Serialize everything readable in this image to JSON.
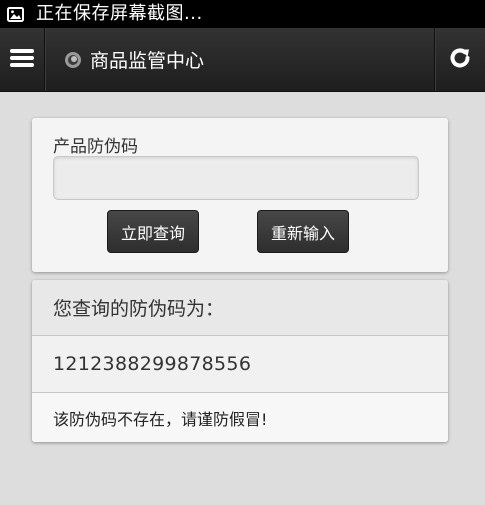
{
  "status_bar": {
    "text": "正在保存屏幕截图...",
    "icon": "image-icon"
  },
  "header": {
    "title": "商品监管中心",
    "menu_icon": "hamburger-menu-icon",
    "logo_icon": "circle-logo-icon",
    "refresh_icon": "refresh-icon"
  },
  "search_form": {
    "label": "产品防伪码",
    "input_value": "",
    "input_placeholder": "",
    "query_button": "立即查询",
    "reset_button": "重新输入"
  },
  "result": {
    "heading": "您查询的防伪码为：",
    "code": "1212388299878556",
    "message": "该防伪码不存在，请谨防假冒!"
  },
  "colors": {
    "status_bar_bg": "#000000",
    "header_bg": "#262626",
    "page_bg": "#dddddd",
    "card_bg": "#f4f4f4",
    "button_bg": "#3a3a3a",
    "button_text": "#ffffff"
  }
}
